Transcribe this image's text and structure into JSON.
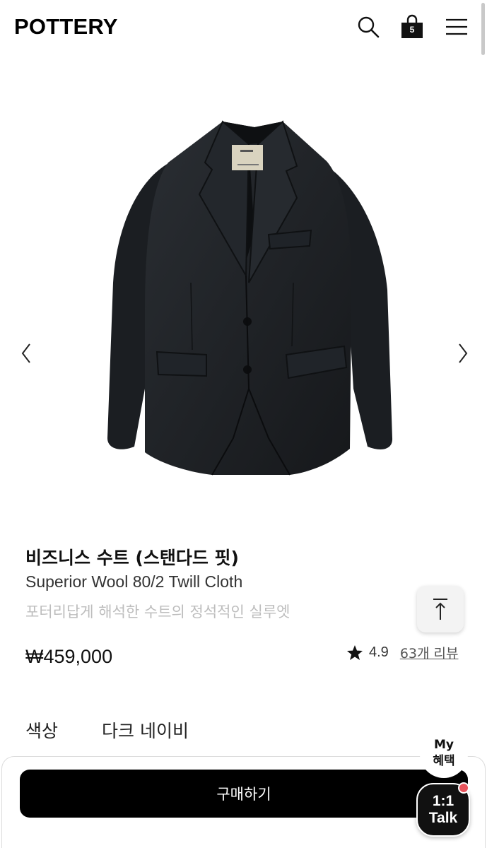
{
  "header": {
    "logo": "POTTERY",
    "cart_count": "5",
    "icons": {
      "search": "search-icon",
      "cart": "shopping-bag-icon",
      "menu": "hamburger-menu-icon"
    }
  },
  "gallery": {
    "image": "product-jacket-image",
    "prev_icon": "chevron-left-icon",
    "next_icon": "chevron-right-icon"
  },
  "product": {
    "title": "비즈니스 수트 (스탠다드 핏)",
    "subtitle": "Superior Wool 80/2 Twill Cloth",
    "description": "포터리답게 해석한 수트의 정석적인 실루엣",
    "price": "₩459,000",
    "rating": "4.9",
    "reviews": "63개 리뷰"
  },
  "options": {
    "color_label": "색상",
    "color_value": "다크 네이비"
  },
  "actions": {
    "buy": "구매하기",
    "my_benefit_line1": "My",
    "my_benefit_line2": "혜택",
    "talk_line1": "1:1",
    "talk_line2": "Talk"
  },
  "colors": {
    "primary": "#000000",
    "muted_text": "#bdbdbd",
    "notification_dot": "#e8535b",
    "jacket": "#1d2024"
  }
}
